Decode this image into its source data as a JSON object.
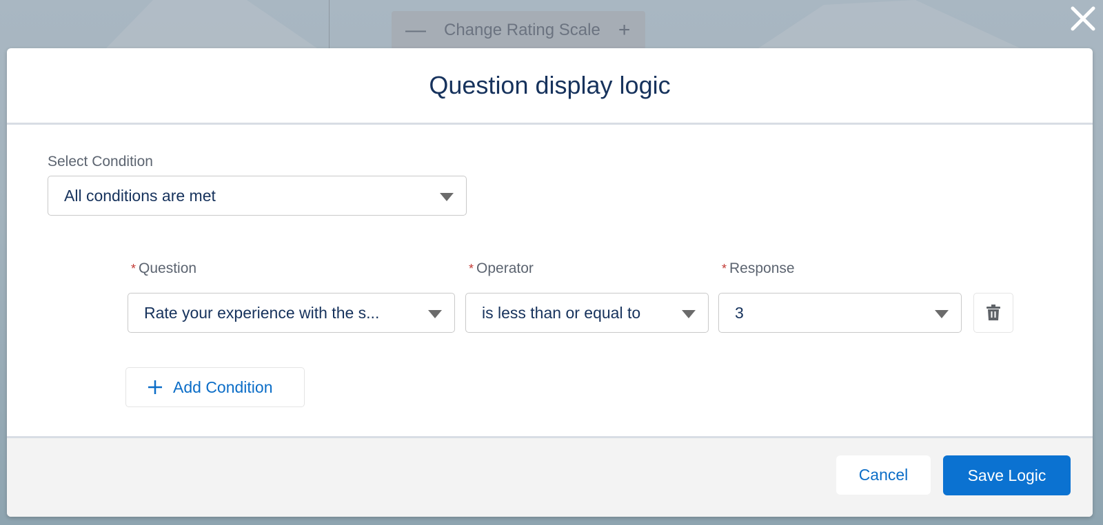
{
  "background": {
    "toolbar_label": "Change Rating Scale",
    "minus_symbol": "—",
    "plus_symbol": "+"
  },
  "modal": {
    "title": "Question display logic",
    "close_icon": "close-icon",
    "select_condition": {
      "label": "Select Condition",
      "value": "All conditions are met"
    },
    "condition_row": {
      "question": {
        "label": "Question",
        "required": "*",
        "value": "Rate your experience with the s..."
      },
      "operator": {
        "label": "Operator",
        "required": "*",
        "value": "is less than or equal to"
      },
      "response": {
        "label": "Response",
        "required": "*",
        "value": "3"
      },
      "delete_icon": "trash-icon"
    },
    "add_condition_label": "Add Condition",
    "footer": {
      "cancel_label": "Cancel",
      "save_label": "Save Logic"
    }
  },
  "colors": {
    "brand_blue": "#0b72d1",
    "link_blue": "#0b6dc7",
    "title_navy": "#16325c",
    "required_red": "#c23934"
  }
}
